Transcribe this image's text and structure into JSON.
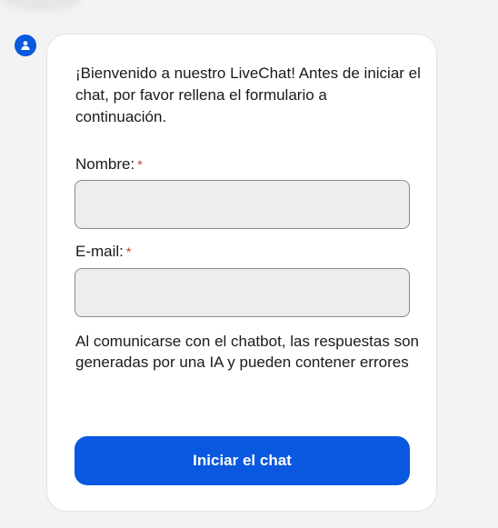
{
  "avatar": {
    "icon": "user-icon",
    "color": "#0a58e0"
  },
  "form": {
    "intro": "¡Bienvenido a nuestro LiveChat! Antes de iniciar el chat, por favor rellena el formulario a continuación.",
    "name_label": "Nombre:",
    "name_value": "",
    "email_label": "E-mail:",
    "email_value": "",
    "required_mark": "*",
    "disclaimer": "Al comunicarse con el chatbot, las respuestas son generadas por una IA y pueden contener errores",
    "submit_label": "Iniciar el chat"
  },
  "colors": {
    "accent": "#0a58e0",
    "required": "#c0392b"
  }
}
